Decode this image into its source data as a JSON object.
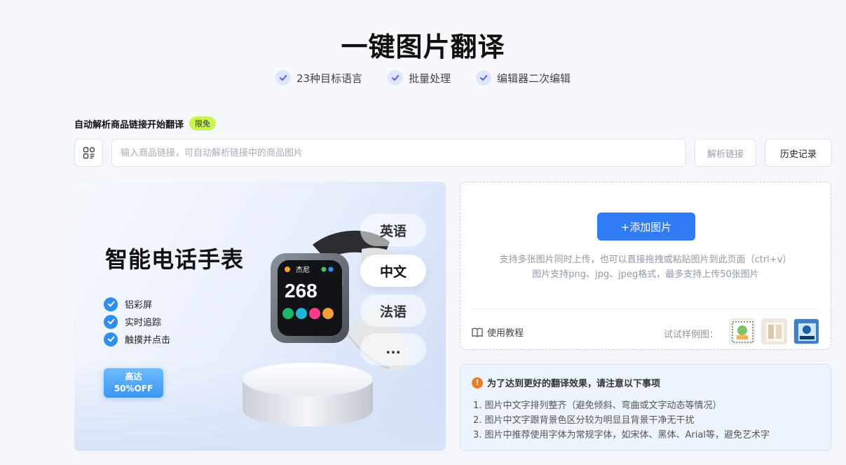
{
  "header": {
    "title": "一键图片翻译",
    "features": [
      "23种目标语言",
      "批量处理",
      "编辑器二次编辑"
    ]
  },
  "link_parse": {
    "label": "自动解析商品链接开始翻译",
    "badge": "限免",
    "placeholder": "输入商品链接，可自动解析链接中的商品图片",
    "value": "",
    "parse_button": "解析链接",
    "history_button": "历史记录"
  },
  "banner": {
    "title": "智能电话手表",
    "features": [
      "铝彩屏",
      "实时追踪",
      "触摸并点击"
    ],
    "promo_line1": "高达",
    "promo_line2": "50%OFF",
    "watch_name": "杰尼",
    "watch_number": "268",
    "languages": [
      "英语",
      "中文",
      "法语",
      "..."
    ],
    "active_language": "中文"
  },
  "upload": {
    "add_button": "+添加图片",
    "hint_line1": "支持多张图片同时上传，也可以直接拖拽或粘贴图片到此页面（ctrl+v）",
    "hint_line2": "图片支持png、jpg、jpeg格式，最多支持上传50张图片",
    "tutorial": "使用教程",
    "sample_label": "试试样例图："
  },
  "notes": {
    "heading": "为了达到更好的翻译效果，请注意以下事项",
    "items": [
      "1. 图片中文字排列整齐（避免倾斜、弯曲或文字动态等情况）",
      "2. 图片中文字跟背景色区分较为明显且背景干净无干扰",
      "3. 图片中推荐使用字体为常规字体，如宋体、黑体、Arial等，避免艺术字"
    ]
  },
  "colors": {
    "primary": "#2f7cf6",
    "badge": "#c8f552",
    "check": "#4d5fe8",
    "warning": "#f07b22"
  }
}
